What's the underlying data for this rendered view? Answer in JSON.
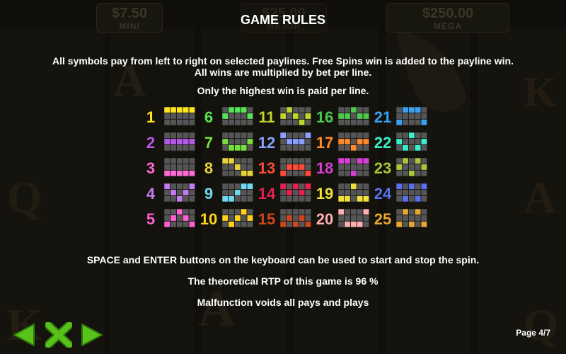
{
  "jackpots": [
    {
      "amount": "$7.50",
      "label": "MINI"
    },
    {
      "amount": "$25.00",
      "label": "MAJOR"
    },
    {
      "amount": "$250.00",
      "label": "MEGA"
    }
  ],
  "title": "GAME RULES",
  "rules": {
    "line1": "All symbols pay from left to right on selected paylines. Free Spins win is added to the payline win.",
    "line2": "All wins are multiplied by bet per line.",
    "line3": "Only the highest win is paid per line.",
    "line4": "SPACE and ENTER buttons on the keyboard can be used to start and stop the spin.",
    "line5": "The theoretical RTP of this game is 96 %",
    "line6": "Malfunction voids all pays and plays"
  },
  "paylines": [
    {
      "num": "1",
      "color": "#ffe51a",
      "rows": [
        0,
        0,
        0,
        0,
        0
      ]
    },
    {
      "num": "2",
      "color": "#b659e8",
      "rows": [
        1,
        1,
        1,
        1,
        1
      ]
    },
    {
      "num": "3",
      "color": "#ff6ad5",
      "rows": [
        2,
        2,
        2,
        2,
        2
      ]
    },
    {
      "num": "4",
      "color": "#c07cf0",
      "rows": [
        0,
        1,
        2,
        1,
        0
      ]
    },
    {
      "num": "5",
      "color": "#ff5fd0",
      "rows": [
        2,
        1,
        0,
        1,
        2
      ]
    },
    {
      "num": "6",
      "color": "#56e356",
      "rows": [
        1,
        0,
        0,
        0,
        1
      ]
    },
    {
      "num": "7",
      "color": "#77e03a",
      "rows": [
        1,
        2,
        2,
        2,
        1
      ]
    },
    {
      "num": "8",
      "color": "#e8d23a",
      "rows": [
        0,
        0,
        1,
        2,
        2
      ]
    },
    {
      "num": "9",
      "color": "#6fd9f2",
      "rows": [
        2,
        2,
        1,
        0,
        0
      ]
    },
    {
      "num": "10",
      "color": "#ffd21a",
      "rows": [
        1,
        2,
        1,
        0,
        1
      ]
    },
    {
      "num": "11",
      "color": "#c0d62a",
      "rows": [
        1,
        0,
        1,
        2,
        1
      ]
    },
    {
      "num": "12",
      "color": "#8aa0ff",
      "rows": [
        0,
        1,
        1,
        1,
        0
      ]
    },
    {
      "num": "13",
      "color": "#ff4a3a",
      "rows": [
        2,
        1,
        1,
        1,
        2
      ]
    },
    {
      "num": "14",
      "color": "#e8204f",
      "rows": [
        0,
        1,
        0,
        1,
        0
      ]
    },
    {
      "num": "15",
      "color": "#d0451e",
      "rows": [
        2,
        1,
        2,
        1,
        2
      ]
    },
    {
      "num": "16",
      "color": "#4ec84e",
      "rows": [
        1,
        1,
        0,
        1,
        1
      ]
    },
    {
      "num": "17",
      "color": "#ff8a2a",
      "rows": [
        1,
        1,
        2,
        1,
        1
      ]
    },
    {
      "num": "18",
      "color": "#d640d6",
      "rows": [
        0,
        0,
        2,
        0,
        0
      ]
    },
    {
      "num": "19",
      "color": "#f0e03a",
      "rows": [
        2,
        2,
        0,
        2,
        2
      ]
    },
    {
      "num": "20",
      "color": "#ffb0b0",
      "rows": [
        0,
        2,
        2,
        2,
        0
      ]
    },
    {
      "num": "21",
      "color": "#3aa0f0",
      "rows": [
        2,
        0,
        0,
        0,
        2
      ]
    },
    {
      "num": "22",
      "color": "#3af0c8",
      "rows": [
        1,
        2,
        0,
        2,
        1
      ]
    },
    {
      "num": "23",
      "color": "#a8c83a",
      "rows": [
        1,
        0,
        2,
        0,
        1
      ]
    },
    {
      "num": "24",
      "color": "#5a6ef0",
      "rows": [
        0,
        2,
        0,
        2,
        0
      ]
    },
    {
      "num": "25",
      "color": "#e8a830",
      "rows": [
        2,
        0,
        2,
        0,
        2
      ]
    }
  ],
  "colors": {
    "cell_empty": "#555555",
    "nav_green": "#58c21b",
    "nav_green_dark": "#2f7a0c"
  },
  "nav": {
    "prev_icon": "left-arrow-icon",
    "close_icon": "x-close-icon",
    "next_icon": "right-arrow-icon"
  },
  "page_indicator": "Page 4/7"
}
